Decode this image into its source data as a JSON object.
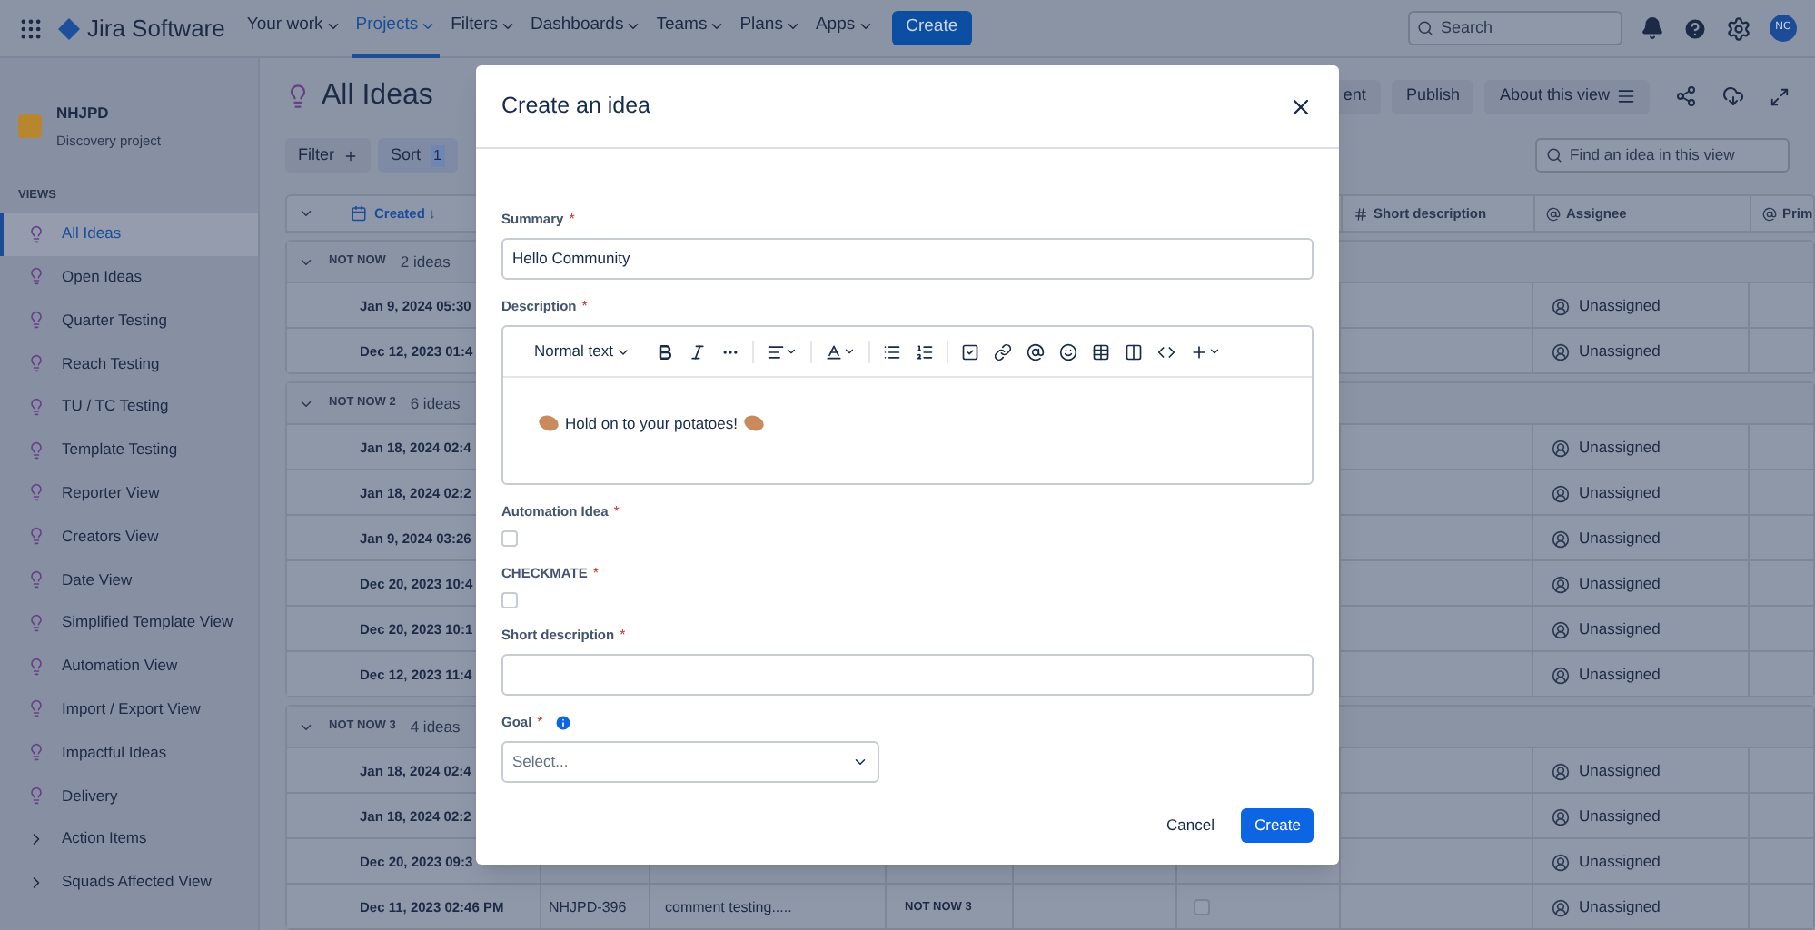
{
  "nav": {
    "product": "Jira Software",
    "menu": [
      {
        "label": "Your work",
        "selected": false
      },
      {
        "label": "Projects",
        "selected": true
      },
      {
        "label": "Filters",
        "selected": false
      },
      {
        "label": "Dashboards",
        "selected": false
      },
      {
        "label": "Teams",
        "selected": false
      },
      {
        "label": "Plans",
        "selected": false
      },
      {
        "label": "Apps",
        "selected": false
      }
    ],
    "create": "Create",
    "search": {
      "placeholder": "Search"
    },
    "avatar": "NC"
  },
  "sidebar": {
    "project": "NHJPD",
    "project_type": "Discovery project",
    "section": "VIEWS",
    "items": [
      {
        "label": "All Ideas",
        "kind": "view",
        "selected": true
      },
      {
        "label": "Open Ideas",
        "kind": "view",
        "selected": false
      },
      {
        "label": "Quarter Testing",
        "kind": "view",
        "selected": false
      },
      {
        "label": "Reach Testing",
        "kind": "view",
        "selected": false
      },
      {
        "label": "TU / TC Testing",
        "kind": "view",
        "selected": false
      },
      {
        "label": "Template Testing",
        "kind": "view",
        "selected": false
      },
      {
        "label": "Reporter View",
        "kind": "view",
        "selected": false
      },
      {
        "label": "Creators View",
        "kind": "view",
        "selected": false
      },
      {
        "label": "Date View",
        "kind": "view",
        "selected": false
      },
      {
        "label": "Simplified Template View",
        "kind": "view",
        "selected": false
      },
      {
        "label": "Automation View",
        "kind": "view",
        "selected": false
      },
      {
        "label": "Import / Export View",
        "kind": "view",
        "selected": false
      },
      {
        "label": "Impactful Ideas",
        "kind": "view",
        "selected": false
      },
      {
        "label": "Delivery",
        "kind": "view",
        "selected": false
      },
      {
        "label": "Action Items",
        "kind": "folder",
        "selected": false
      },
      {
        "label": "Squads Affected View",
        "kind": "folder",
        "selected": false
      }
    ]
  },
  "view": {
    "title": "All Ideas",
    "actions": [
      "ent",
      "Publish",
      "About this view"
    ],
    "filter": "Filter",
    "sort": "Sort",
    "sort_count": "1",
    "search": {
      "placeholder": "Find an idea in this view"
    }
  },
  "table": {
    "columns": [
      {
        "label": "Created ↓",
        "kind": "date"
      },
      {
        "label": "Short description",
        "kind": "text"
      },
      {
        "label": "Assignee",
        "kind": "person"
      },
      {
        "label": "Prim",
        "kind": "person"
      }
    ],
    "groups": [
      {
        "label": "NOT NOW",
        "count": "2 ideas",
        "expanded": true,
        "rows": [
          {
            "created": "Jan 9, 2024 05:30",
            "assignee": "Unassigned"
          },
          {
            "created": "Dec 12, 2023 01:4",
            "assignee": "Unassigned"
          }
        ]
      },
      {
        "label": "NOT NOW 2",
        "count": "6 ideas",
        "expanded": true,
        "rows": [
          {
            "created": "Jan 18, 2024 02:4",
            "assignee": "Unassigned"
          },
          {
            "created": "Jan 18, 2024 02:2",
            "assignee": "Unassigned"
          },
          {
            "created": "Jan 9, 2024 03:26",
            "assignee": "Unassigned"
          },
          {
            "created": "Dec 20, 2023 10:4",
            "assignee": "Unassigned"
          },
          {
            "created": "Dec 20, 2023 10:1",
            "assignee": "Unassigned"
          },
          {
            "created": "Dec 12, 2023 11:4",
            "assignee": "Unassigned"
          }
        ]
      },
      {
        "label": "NOT NOW 3",
        "count": "4 ideas",
        "expanded": true,
        "rows": [
          {
            "created": "Jan 18, 2024 02:4",
            "assignee": "Unassigned"
          },
          {
            "created": "Jan 18, 2024 02:2",
            "assignee": "Unassigned"
          },
          {
            "created": "Dec 20, 2023 09:3",
            "assignee": "Unassigned"
          },
          {
            "created": "Dec 11, 2023 02:46 PM",
            "key": "NHJPD-396",
            "summary": "comment testing.....",
            "status": "NOT NOW 3",
            "checked": false,
            "assignee": "Unassigned"
          }
        ]
      }
    ]
  },
  "dialog": {
    "title": "Create an idea",
    "fields": [
      {
        "label": "Summary",
        "required_mark": "*",
        "kind": "text",
        "value": "Hello Community"
      },
      {
        "label": "Description",
        "required_mark": "*",
        "kind": "editor",
        "style": "Normal text",
        "value": "Hold on to your potatoes!"
      },
      {
        "label": "Automation Idea",
        "required_mark": "*",
        "kind": "checkbox",
        "checked": false
      },
      {
        "label": "CHECKMATE",
        "required_mark": "*",
        "kind": "checkbox",
        "checked": false
      },
      {
        "label": "Short description",
        "required_mark": "*",
        "kind": "text"
      },
      {
        "label": "Goal",
        "required_mark": "*",
        "kind": "select",
        "info": true,
        "placeholder": "Select..."
      }
    ],
    "buttons": [
      {
        "label": "Cancel",
        "kind": "subtle"
      },
      {
        "label": "Create",
        "kind": "primary"
      }
    ]
  }
}
